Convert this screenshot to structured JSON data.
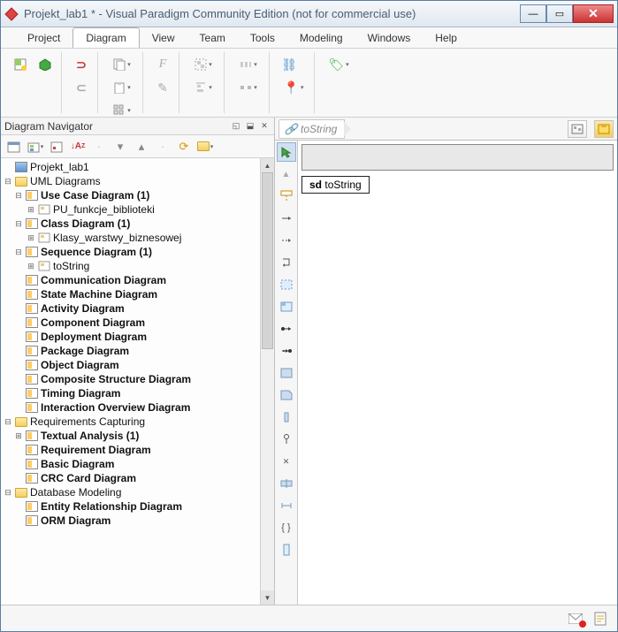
{
  "title": "Projekt_lab1 * - Visual Paradigm Community Edition (not for commercial use)",
  "menu": [
    "Project",
    "Diagram",
    "View",
    "Team",
    "Tools",
    "Modeling",
    "Windows",
    "Help"
  ],
  "menu_active": 1,
  "navigator": {
    "title": "Diagram Navigator",
    "project": "Projekt_lab1",
    "sections": [
      {
        "name": "UML Diagrams",
        "open": true,
        "items": [
          {
            "label": "Use Case Diagram (1)",
            "bold": true,
            "open": true,
            "children": [
              {
                "label": "PU_funkcje_biblioteki",
                "bold": false
              }
            ]
          },
          {
            "label": "Class Diagram (1)",
            "bold": true,
            "open": true,
            "children": [
              {
                "label": "Klasy_warstwy_biznesowej",
                "bold": false
              }
            ]
          },
          {
            "label": "Sequence Diagram (1)",
            "bold": true,
            "open": true,
            "children": [
              {
                "label": "toString",
                "bold": false
              }
            ]
          },
          {
            "label": "Communication Diagram",
            "bold": true
          },
          {
            "label": "State Machine Diagram",
            "bold": true
          },
          {
            "label": "Activity Diagram",
            "bold": true
          },
          {
            "label": "Component Diagram",
            "bold": true
          },
          {
            "label": "Deployment Diagram",
            "bold": true
          },
          {
            "label": "Package Diagram",
            "bold": true
          },
          {
            "label": "Object Diagram",
            "bold": true
          },
          {
            "label": "Composite Structure Diagram",
            "bold": true
          },
          {
            "label": "Timing Diagram",
            "bold": true
          },
          {
            "label": "Interaction Overview Diagram",
            "bold": true
          }
        ]
      },
      {
        "name": "Requirements Capturing",
        "open": true,
        "items": [
          {
            "label": "Textual Analysis (1)",
            "bold": true,
            "closed": true
          },
          {
            "label": "Requirement Diagram",
            "bold": true
          },
          {
            "label": "Basic Diagram",
            "bold": true
          },
          {
            "label": "CRC Card Diagram",
            "bold": true
          }
        ]
      },
      {
        "name": "Database Modeling",
        "open": true,
        "items": [
          {
            "label": "Entity Relationship Diagram",
            "bold": true
          },
          {
            "label": "ORM Diagram",
            "bold": true
          }
        ]
      }
    ]
  },
  "tab": {
    "name": "toString"
  },
  "frame": {
    "prefix": "sd",
    "name": "toString"
  }
}
